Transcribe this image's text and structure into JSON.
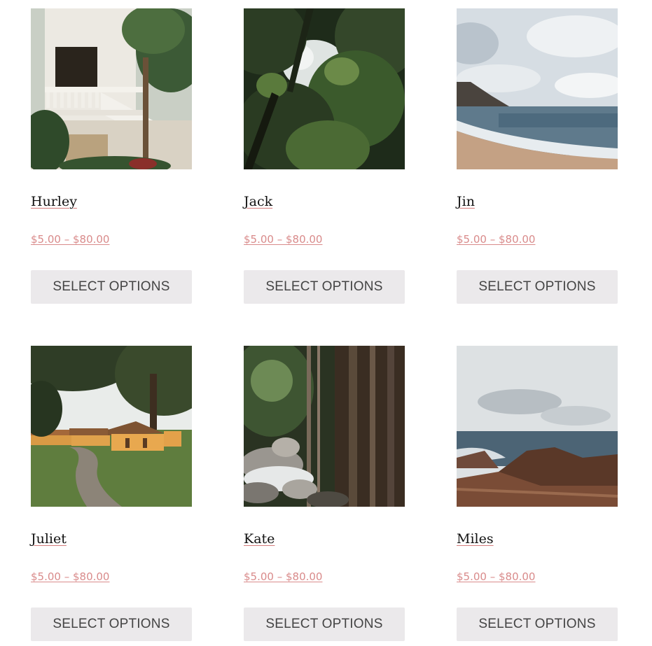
{
  "products": [
    {
      "name": "Hurley",
      "price": "$5.00 – $80.00",
      "button": "SELECT OPTIONS",
      "image": "villa-balcony-image"
    },
    {
      "name": "Jack",
      "price": "$5.00 – $80.00",
      "button": "SELECT OPTIONS",
      "image": "jungle-canopy-image"
    },
    {
      "name": "Jin",
      "price": "$5.00 – $80.00",
      "button": "SELECT OPTIONS",
      "image": "beach-shoreline-image"
    },
    {
      "name": "Juliet",
      "price": "$5.00 – $80.00",
      "button": "SELECT OPTIONS",
      "image": "barracks-village-image"
    },
    {
      "name": "Kate",
      "price": "$5.00 – $80.00",
      "button": "SELECT OPTIONS",
      "image": "jungle-stream-image"
    },
    {
      "name": "Miles",
      "price": "$5.00 – $80.00",
      "button": "SELECT OPTIONS",
      "image": "rocky-coast-image"
    }
  ],
  "colors": {
    "title_underline": "#d47b7b",
    "price": "#d98b8b",
    "button_bg": "#ebe9eb",
    "button_text": "#444444"
  }
}
